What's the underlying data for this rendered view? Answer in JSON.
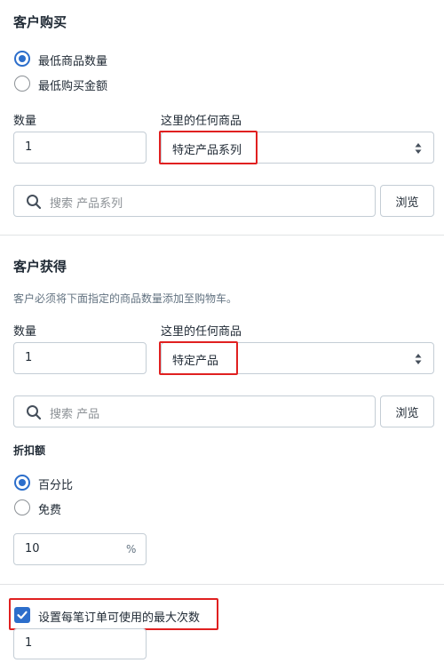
{
  "buy": {
    "title": "客户购买",
    "option_min_qty": "最低商品数量",
    "option_min_amount": "最低购买金额",
    "qty_label": "数量",
    "qty_value": "1",
    "items_label": "这里的任何商品",
    "items_select": "特定产品系列",
    "search_placeholder": "搜索 产品系列",
    "browse_label": "浏览"
  },
  "get": {
    "title": "客户获得",
    "description": "客户必须将下面指定的商品数量添加至购物车。",
    "qty_label": "数量",
    "qty_value": "1",
    "items_label": "这里的任何商品",
    "items_select": "特定产品",
    "search_placeholder": "搜索 产品",
    "browse_label": "浏览"
  },
  "discount": {
    "label": "折扣额",
    "option_percent": "百分比",
    "option_free": "免费",
    "value": "10",
    "suffix": "%"
  },
  "limit": {
    "checkbox_label": "设置每笔订单可使用的最大次数",
    "value": "1"
  },
  "colors": {
    "accent": "#2c6ecb",
    "highlight": "#e02020"
  }
}
